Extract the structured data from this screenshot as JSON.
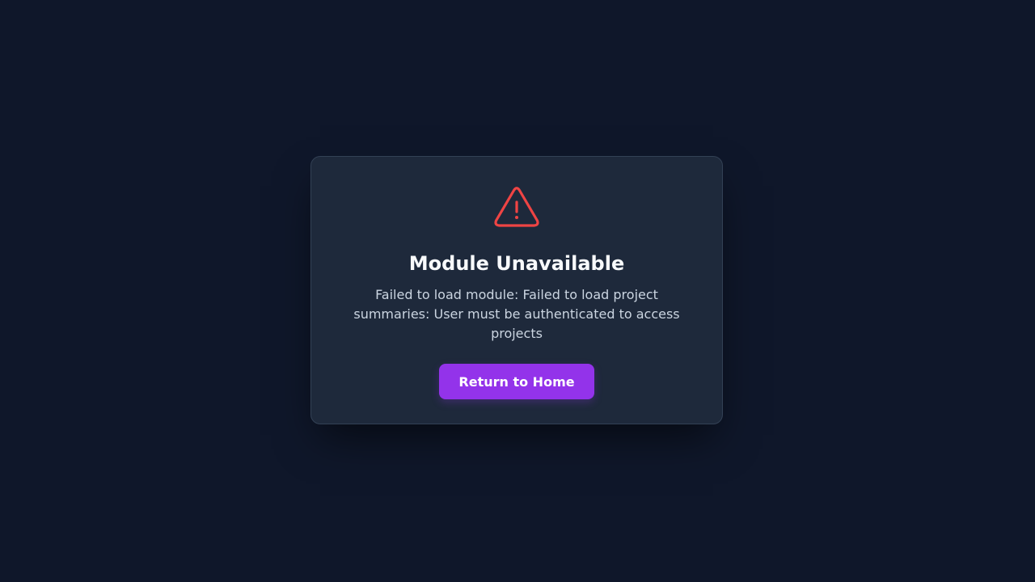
{
  "error": {
    "icon": "warning-triangle-icon",
    "title": "Module Unavailable",
    "message": "Failed to load module: Failed to load project summaries: User must be authenticated to access projects",
    "button_label": "Return to Home"
  },
  "colors": {
    "background": "#0f172a",
    "card": "#1e293b",
    "warning": "#ef4444",
    "accent": "#9333ea"
  }
}
